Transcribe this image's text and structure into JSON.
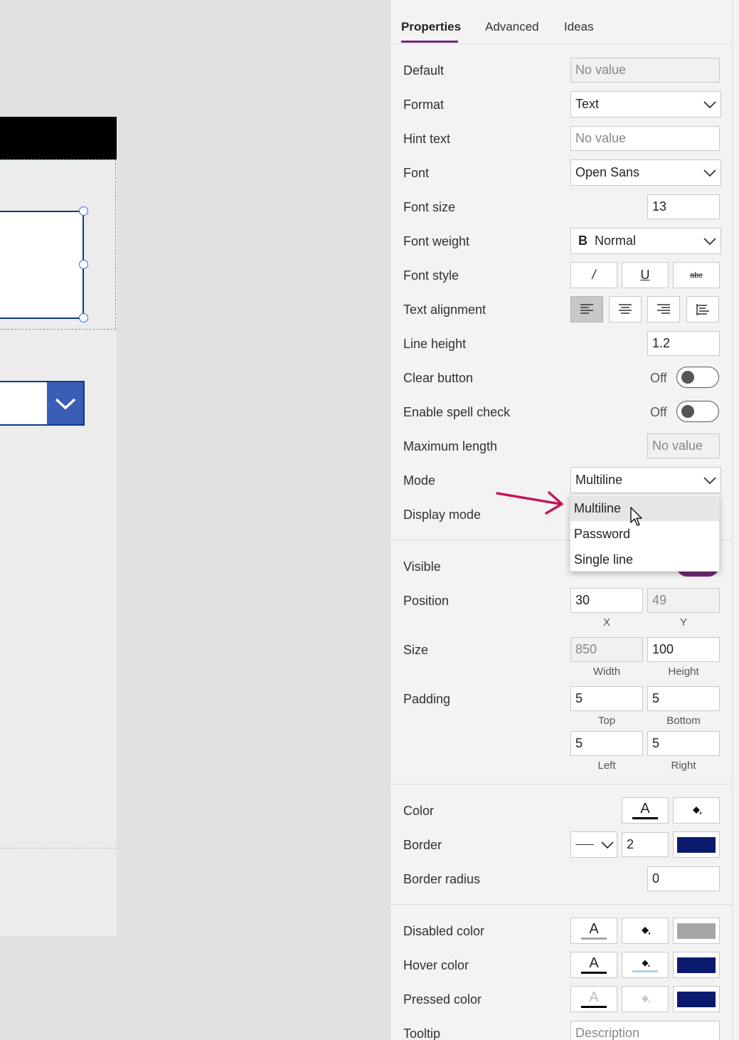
{
  "tabs": [
    "Properties",
    "Advanced",
    "Ideas"
  ],
  "props": {
    "default": {
      "label": "Default",
      "placeholder": "No value"
    },
    "format": {
      "label": "Format",
      "value": "Text"
    },
    "hint": {
      "label": "Hint text",
      "placeholder": "No value"
    },
    "font": {
      "label": "Font",
      "value": "Open Sans"
    },
    "font_size": {
      "label": "Font size",
      "value": "13"
    },
    "font_weight": {
      "label": "Font weight",
      "icon": "B",
      "value": "Normal"
    },
    "font_style": {
      "label": "Font style",
      "italic": "/",
      "underline": "U",
      "strike": "abc"
    },
    "text_align": {
      "label": "Text alignment"
    },
    "line_height": {
      "label": "Line height",
      "value": "1.2"
    },
    "clear_button": {
      "label": "Clear button",
      "state": "Off"
    },
    "spell_check": {
      "label": "Enable spell check",
      "state": "Off"
    },
    "max_length": {
      "label": "Maximum length",
      "placeholder": "No value"
    },
    "mode": {
      "label": "Mode",
      "value": "Multiline",
      "options": [
        "Multiline",
        "Password",
        "Single line"
      ]
    },
    "display_mode": {
      "label": "Display mode"
    },
    "visible": {
      "label": "Visible"
    },
    "position": {
      "label": "Position",
      "x": "30",
      "y": "49",
      "x_label": "X",
      "y_label": "Y"
    },
    "size": {
      "label": "Size",
      "width": "850",
      "height": "100",
      "width_label": "Width",
      "height_label": "Height"
    },
    "padding": {
      "label": "Padding",
      "top": "5",
      "bottom": "5",
      "left": "5",
      "right": "5",
      "top_label": "Top",
      "bottom_label": "Bottom",
      "left_label": "Left",
      "right_label": "Right"
    },
    "color": {
      "label": "Color",
      "text_glyph": "A"
    },
    "border": {
      "label": "Border",
      "thickness": "2",
      "swatch": "#0a1a6e"
    },
    "border_radius": {
      "label": "Border radius",
      "value": "0"
    },
    "disabled_color": {
      "label": "Disabled color",
      "text_glyph": "A",
      "swatch": "#a6a6a6"
    },
    "hover_color": {
      "label": "Hover color",
      "text_glyph": "A",
      "swatch": "#0a1a6e"
    },
    "pressed_color": {
      "label": "Pressed color",
      "text_glyph": "A",
      "swatch": "#0a1a6e"
    },
    "tooltip": {
      "label": "Tooltip",
      "placeholder": "Description"
    }
  },
  "colors": {
    "accent": "#742774",
    "arrow": "#c2185b",
    "canvas_header": "#000000",
    "combo_button": "#3a5db6"
  }
}
